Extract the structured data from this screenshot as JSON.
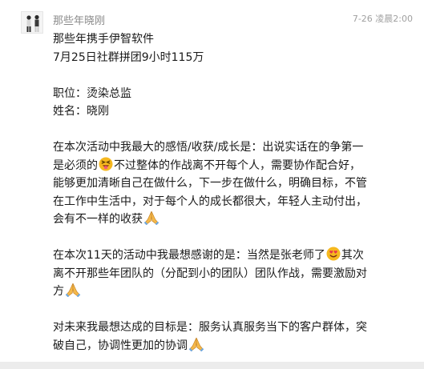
{
  "contact": {
    "name": "那些年晓刚",
    "time": "7-26 凌晨2:00"
  },
  "message": {
    "l1": "那些年携手伊智软件",
    "l2": "7月25日社群拼团9小时115万",
    "l3": "职位：烫染总监",
    "l4": "姓名：晓刚",
    "p1_l1": "在本次活动中我最大的感悟/收获/成长是：出说实话在的争第一",
    "p1_l2a": "是必须的",
    "p1_l2b": "不过整体的作战离不开每个人，需要协作配合好，",
    "p1_l3": "能够更加清晰自己在做什么，下一步在做什么，明确目标，不管",
    "p1_l4": "在工作中生活中，对于每个人的成长都很大，年轻人主动付出，",
    "p1_l5": "会有不一样的收获",
    "p2_l1a": "在本次11天的活动中我最想感谢的是：当然是张老师了",
    "p2_l1b": "其次",
    "p2_l2": "离不开那些年团队的（分配到小的团队）团队作战，需要激励对",
    "p2_l3": "方",
    "p3_l1": "对未来我最想达成的目标是：服务认真服务当下的客户群体，突",
    "p3_l2": "破自己，协调性更加的协调"
  },
  "emojis": [
    "squinting-tongue-emoji",
    "pray-hands-emoji",
    "smiling-heart-eyes-emoji",
    "pray-hands-emoji",
    "pray-hands-emoji"
  ]
}
